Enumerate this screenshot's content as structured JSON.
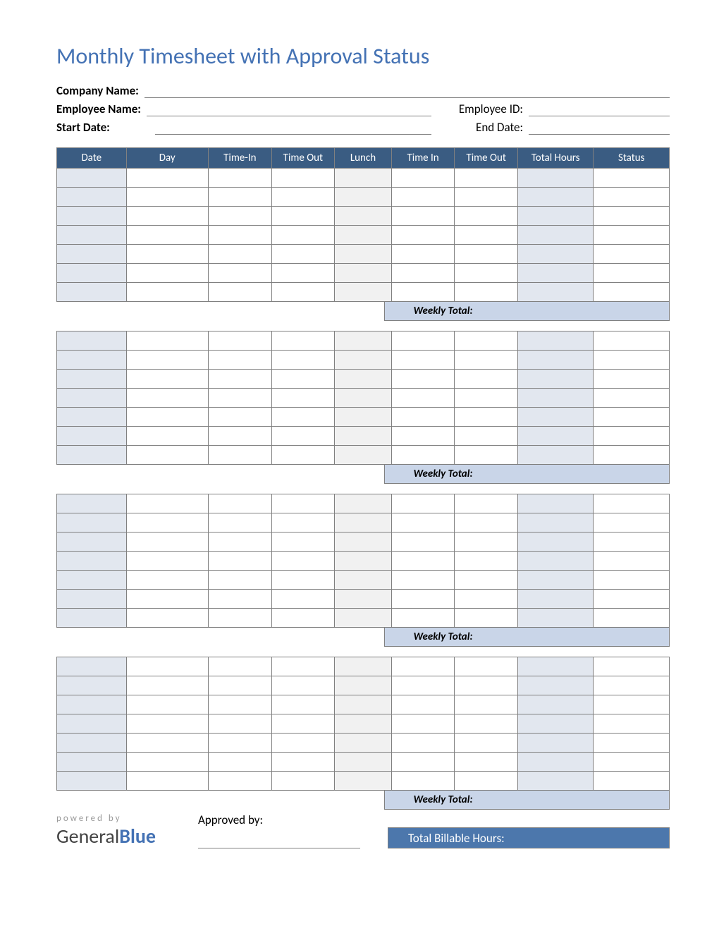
{
  "title": "Monthly Timesheet with Approval Status",
  "labels": {
    "company_name": "Company Name:",
    "employee_name": "Employee Name:",
    "employee_id": "Employee ID:",
    "start_date": "Start Date:",
    "end_date": "End Date:",
    "weekly_total": "Weekly Total:",
    "approved_by": "Approved by:",
    "total_billable": "Total Billable Hours:",
    "powered_by": "powered by",
    "logo_a": "General",
    "logo_b": "Blue"
  },
  "fields": {
    "company_name": "",
    "employee_name": "",
    "employee_id": "",
    "start_date": "",
    "end_date": "",
    "approved_by": "",
    "total_billable_hours": ""
  },
  "columns": [
    "Date",
    "Day",
    "Time-In",
    "Time Out",
    "Lunch",
    "Time In",
    "Time Out",
    "Total Hours",
    "Status"
  ],
  "weeks": [
    {
      "weekly_total": "",
      "rows": [
        {
          "date": "",
          "day": "",
          "time_in_1": "",
          "time_out_1": "",
          "lunch": "",
          "time_in_2": "",
          "time_out_2": "",
          "total_hours": "",
          "status": ""
        },
        {
          "date": "",
          "day": "",
          "time_in_1": "",
          "time_out_1": "",
          "lunch": "",
          "time_in_2": "",
          "time_out_2": "",
          "total_hours": "",
          "status": ""
        },
        {
          "date": "",
          "day": "",
          "time_in_1": "",
          "time_out_1": "",
          "lunch": "",
          "time_in_2": "",
          "time_out_2": "",
          "total_hours": "",
          "status": ""
        },
        {
          "date": "",
          "day": "",
          "time_in_1": "",
          "time_out_1": "",
          "lunch": "",
          "time_in_2": "",
          "time_out_2": "",
          "total_hours": "",
          "status": ""
        },
        {
          "date": "",
          "day": "",
          "time_in_1": "",
          "time_out_1": "",
          "lunch": "",
          "time_in_2": "",
          "time_out_2": "",
          "total_hours": "",
          "status": ""
        },
        {
          "date": "",
          "day": "",
          "time_in_1": "",
          "time_out_1": "",
          "lunch": "",
          "time_in_2": "",
          "time_out_2": "",
          "total_hours": "",
          "status": ""
        },
        {
          "date": "",
          "day": "",
          "time_in_1": "",
          "time_out_1": "",
          "lunch": "",
          "time_in_2": "",
          "time_out_2": "",
          "total_hours": "",
          "status": ""
        }
      ]
    },
    {
      "weekly_total": "",
      "rows": [
        {
          "date": "",
          "day": "",
          "time_in_1": "",
          "time_out_1": "",
          "lunch": "",
          "time_in_2": "",
          "time_out_2": "",
          "total_hours": "",
          "status": ""
        },
        {
          "date": "",
          "day": "",
          "time_in_1": "",
          "time_out_1": "",
          "lunch": "",
          "time_in_2": "",
          "time_out_2": "",
          "total_hours": "",
          "status": ""
        },
        {
          "date": "",
          "day": "",
          "time_in_1": "",
          "time_out_1": "",
          "lunch": "",
          "time_in_2": "",
          "time_out_2": "",
          "total_hours": "",
          "status": ""
        },
        {
          "date": "",
          "day": "",
          "time_in_1": "",
          "time_out_1": "",
          "lunch": "",
          "time_in_2": "",
          "time_out_2": "",
          "total_hours": "",
          "status": ""
        },
        {
          "date": "",
          "day": "",
          "time_in_1": "",
          "time_out_1": "",
          "lunch": "",
          "time_in_2": "",
          "time_out_2": "",
          "total_hours": "",
          "status": ""
        },
        {
          "date": "",
          "day": "",
          "time_in_1": "",
          "time_out_1": "",
          "lunch": "",
          "time_in_2": "",
          "time_out_2": "",
          "total_hours": "",
          "status": ""
        },
        {
          "date": "",
          "day": "",
          "time_in_1": "",
          "time_out_1": "",
          "lunch": "",
          "time_in_2": "",
          "time_out_2": "",
          "total_hours": "",
          "status": ""
        }
      ]
    },
    {
      "weekly_total": "",
      "rows": [
        {
          "date": "",
          "day": "",
          "time_in_1": "",
          "time_out_1": "",
          "lunch": "",
          "time_in_2": "",
          "time_out_2": "",
          "total_hours": "",
          "status": ""
        },
        {
          "date": "",
          "day": "",
          "time_in_1": "",
          "time_out_1": "",
          "lunch": "",
          "time_in_2": "",
          "time_out_2": "",
          "total_hours": "",
          "status": ""
        },
        {
          "date": "",
          "day": "",
          "time_in_1": "",
          "time_out_1": "",
          "lunch": "",
          "time_in_2": "",
          "time_out_2": "",
          "total_hours": "",
          "status": ""
        },
        {
          "date": "",
          "day": "",
          "time_in_1": "",
          "time_out_1": "",
          "lunch": "",
          "time_in_2": "",
          "time_out_2": "",
          "total_hours": "",
          "status": ""
        },
        {
          "date": "",
          "day": "",
          "time_in_1": "",
          "time_out_1": "",
          "lunch": "",
          "time_in_2": "",
          "time_out_2": "",
          "total_hours": "",
          "status": ""
        },
        {
          "date": "",
          "day": "",
          "time_in_1": "",
          "time_out_1": "",
          "lunch": "",
          "time_in_2": "",
          "time_out_2": "",
          "total_hours": "",
          "status": ""
        },
        {
          "date": "",
          "day": "",
          "time_in_1": "",
          "time_out_1": "",
          "lunch": "",
          "time_in_2": "",
          "time_out_2": "",
          "total_hours": "",
          "status": ""
        }
      ]
    },
    {
      "weekly_total": "",
      "rows": [
        {
          "date": "",
          "day": "",
          "time_in_1": "",
          "time_out_1": "",
          "lunch": "",
          "time_in_2": "",
          "time_out_2": "",
          "total_hours": "",
          "status": ""
        },
        {
          "date": "",
          "day": "",
          "time_in_1": "",
          "time_out_1": "",
          "lunch": "",
          "time_in_2": "",
          "time_out_2": "",
          "total_hours": "",
          "status": ""
        },
        {
          "date": "",
          "day": "",
          "time_in_1": "",
          "time_out_1": "",
          "lunch": "",
          "time_in_2": "",
          "time_out_2": "",
          "total_hours": "",
          "status": ""
        },
        {
          "date": "",
          "day": "",
          "time_in_1": "",
          "time_out_1": "",
          "lunch": "",
          "time_in_2": "",
          "time_out_2": "",
          "total_hours": "",
          "status": ""
        },
        {
          "date": "",
          "day": "",
          "time_in_1": "",
          "time_out_1": "",
          "lunch": "",
          "time_in_2": "",
          "time_out_2": "",
          "total_hours": "",
          "status": ""
        },
        {
          "date": "",
          "day": "",
          "time_in_1": "",
          "time_out_1": "",
          "lunch": "",
          "time_in_2": "",
          "time_out_2": "",
          "total_hours": "",
          "status": ""
        },
        {
          "date": "",
          "day": "",
          "time_in_1": "",
          "time_out_1": "",
          "lunch": "",
          "time_in_2": "",
          "time_out_2": "",
          "total_hours": "",
          "status": ""
        }
      ]
    }
  ]
}
